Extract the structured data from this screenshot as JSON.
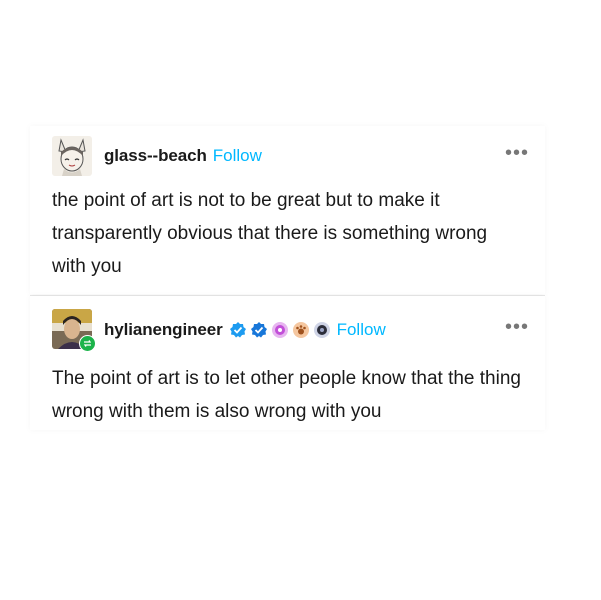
{
  "posts": [
    {
      "username": "glass--beach",
      "follow_label": "Follow",
      "more_label": "•••",
      "avatar_icon": "anime-fox-avatar",
      "text": "the point of art is not to be great but to make it transparently obvious that there is something wrong with you"
    },
    {
      "username": "hylianengineer",
      "follow_label": "Follow",
      "more_label": "•••",
      "avatar_icon": "person-photo-avatar",
      "badges": [
        "verified-badge-blue",
        "verified-badge-blue-2",
        "pink-badge",
        "orange-paw-badge",
        "dark-badge"
      ],
      "reblog_icon": "reblog-icon",
      "text": "The point of art is to let other people know that the thing wrong with them is also wrong with you"
    }
  ],
  "colors": {
    "follow": "#00b8ff",
    "verified": "#1d9bf0",
    "reblog": "#1bb34a"
  }
}
